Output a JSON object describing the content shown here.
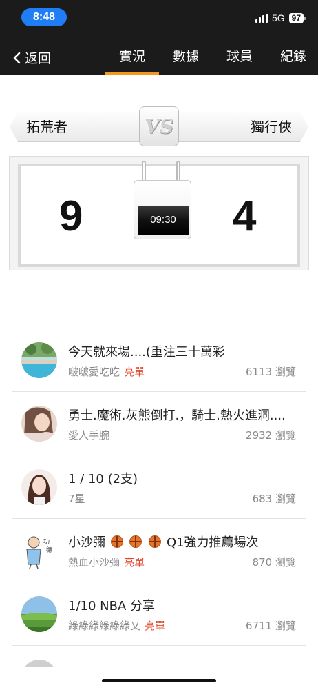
{
  "status_bar": {
    "time": "8:48",
    "network": "5G",
    "battery": "97"
  },
  "nav": {
    "back_label": "返回",
    "tabs": [
      {
        "label": "實況",
        "active": true
      },
      {
        "label": "數據",
        "active": false
      },
      {
        "label": "球員",
        "active": false
      },
      {
        "label": "紀錄",
        "active": false
      }
    ]
  },
  "match": {
    "home_team": "拓荒者",
    "away_team": "獨行俠",
    "vs_label": "VS",
    "home_score": "9",
    "away_score": "4",
    "clock": "09:30"
  },
  "posts": [
    {
      "title": "今天就來場....(重注三十萬彩",
      "author": "啵啵愛吃吃",
      "tag": "亮單",
      "views": "6113 瀏覽",
      "avatar": "pool-photo"
    },
    {
      "title": "勇士.魔術.灰熊倒打.，騎士.熱火進洞....",
      "author": "愛人手腕",
      "tag": "",
      "views": "2932 瀏覽",
      "avatar": "woman-photo"
    },
    {
      "title": "1 / 10 (2支)",
      "author": "7星",
      "tag": "",
      "views": "683 瀏覽",
      "avatar": "woman-portrait"
    },
    {
      "title_prefix": "小沙彌",
      "title_suffix": "Q1強力推薦場次",
      "author": "熱血小沙彌",
      "tag": "亮單",
      "views": "870 瀏覽",
      "avatar": "monk-cartoon"
    },
    {
      "title": "1/10 NBA 分享",
      "author": "綠綠綠綠綠綠乂",
      "tag": "亮單",
      "views": "6711 瀏覽",
      "avatar": "landscape-photo"
    }
  ],
  "colors": {
    "accent": "#f39a1e",
    "tag": "#e0482c",
    "header_bg": "#1b1b1b",
    "time_pill": "#1f7ef5"
  }
}
